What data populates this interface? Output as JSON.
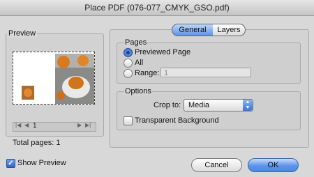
{
  "window": {
    "title": "Place PDF (076-077_CMYK_GSO.pdf)"
  },
  "preview": {
    "label": "Preview",
    "page_field": "1",
    "total_pages": "Total pages: 1",
    "show_preview_label": "Show Preview"
  },
  "tabs": [
    {
      "label": "General",
      "selected": true
    },
    {
      "label": "Layers",
      "selected": false
    }
  ],
  "pages": {
    "label": "Pages",
    "options": [
      {
        "label": "Previewed Page",
        "selected": true
      },
      {
        "label": "All",
        "selected": false
      },
      {
        "label": "Range:",
        "selected": false
      }
    ],
    "range_value": "1"
  },
  "options": {
    "label": "Options",
    "crop_label": "Crop to:",
    "crop_value": "Media",
    "transparent_label": "Transparent Background"
  },
  "buttons": {
    "cancel": "Cancel",
    "ok": "OK"
  }
}
